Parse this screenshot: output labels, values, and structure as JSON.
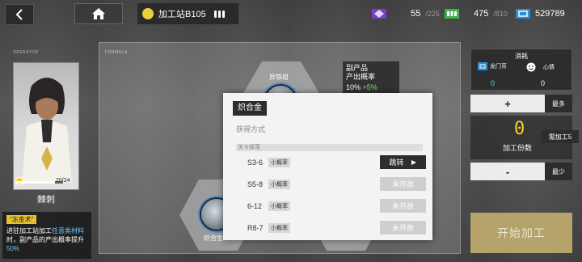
{
  "topbar": {
    "station_name": "加工站B105",
    "resources": [
      {
        "icon": "sanity-icon",
        "value": "55",
        "max": "/225"
      },
      {
        "icon": "battery-icon",
        "value": "475",
        "max": "/810"
      },
      {
        "icon": "lmd-icon",
        "value": "529789"
      }
    ]
  },
  "operator": {
    "section_label": "OPERATOR",
    "name": "棘刺",
    "exp": "20/24",
    "skill_title": "“冻金术”",
    "skill_text_1": "进驻加工站加工",
    "skill_text_hl": "任意类材料",
    "skill_text_2": "时，副产品的产出概率提升",
    "skill_text_pct": "50%"
  },
  "formula": {
    "section_label": "FORMULA",
    "ingredient_label": "异铁组",
    "product_label": "炽合金",
    "byproduct_title_1": "副产品",
    "byproduct_title_2": "产出概率",
    "byproduct_value": "10%",
    "byproduct_bonus": "+5%"
  },
  "consume": {
    "title": "消耗",
    "lmd_label": "龙门币",
    "lmd_value": "0",
    "mood_label": "心情",
    "mood_value": "0"
  },
  "quantity": {
    "plus_label": "+",
    "max_label": "最多",
    "value": "0",
    "label": "加工份数",
    "minus_label": "-",
    "min_label": "最少",
    "need_label": "需加工5"
  },
  "start_label": "开始加工",
  "popup": {
    "title": "炽合金",
    "subtitle": "获得方式",
    "section": "关卡掉落",
    "stages": [
      {
        "name": "S3-6",
        "prob": "小概率",
        "action": "跳转",
        "action_type": "jump"
      },
      {
        "name": "S5-8",
        "prob": "小概率",
        "action": "未开放",
        "action_type": "closed"
      },
      {
        "name": "6-12",
        "prob": "小概率",
        "action": "未开放",
        "action_type": "closed"
      },
      {
        "name": "R8-7",
        "prob": "小概率",
        "action": "未开放",
        "action_type": "closed"
      }
    ]
  },
  "colors": {
    "accent_yellow": "#f2d21f",
    "accent_blue": "#6cc7ff",
    "start_button": "#b5a36a"
  }
}
